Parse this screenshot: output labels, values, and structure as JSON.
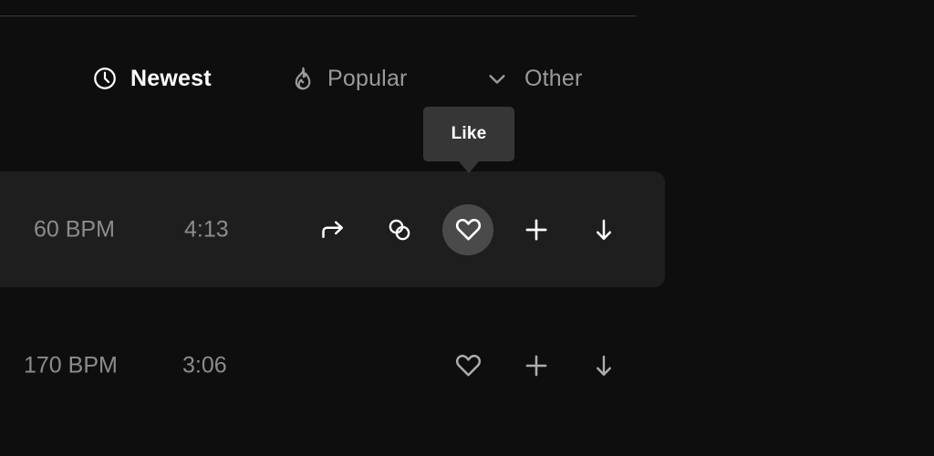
{
  "theme": {
    "page_bg": "#0e0e0e",
    "row_highlight_bg": "#1e1e1e",
    "tooltip_bg": "#363636",
    "hover_circle_bg": "#4a4a4a",
    "active_text": "#ffffff",
    "muted_text": "#9a9a9a",
    "meta_text": "#8c8c8c",
    "divider": "#3a3a3a"
  },
  "divider": {
    "name": "section-divider"
  },
  "tabbar": {
    "name": "sort-tabbar",
    "tabs": [
      {
        "id": "newest",
        "label": "Newest",
        "icon": "clock-icon",
        "active": true
      },
      {
        "id": "popular",
        "label": "Popular",
        "icon": "flame-icon",
        "active": false
      },
      {
        "id": "other",
        "label": "Other",
        "icon": "chevron-down-icon",
        "active": false
      }
    ]
  },
  "tooltip": {
    "text": "Like",
    "target": "like-button",
    "visible": true
  },
  "tracks": [
    {
      "id": "track-1",
      "bpm": "60 BPM",
      "duration": "4:13",
      "highlighted": true,
      "actions": [
        {
          "id": "share",
          "icon": "share-arrow-icon",
          "hovered": false
        },
        {
          "id": "stems",
          "icon": "interlocking-circles-icon",
          "hovered": false
        },
        {
          "id": "like",
          "icon": "heart-icon",
          "hovered": true
        },
        {
          "id": "add",
          "icon": "plus-icon",
          "hovered": false
        },
        {
          "id": "download",
          "icon": "download-arrow-icon",
          "hovered": false
        }
      ]
    },
    {
      "id": "track-2",
      "bpm": "170 BPM",
      "duration": "3:06",
      "highlighted": false,
      "actions": [
        {
          "id": "like",
          "icon": "heart-icon",
          "hovered": false
        },
        {
          "id": "add",
          "icon": "plus-icon",
          "hovered": false
        },
        {
          "id": "download",
          "icon": "download-arrow-icon",
          "hovered": false
        }
      ]
    }
  ]
}
